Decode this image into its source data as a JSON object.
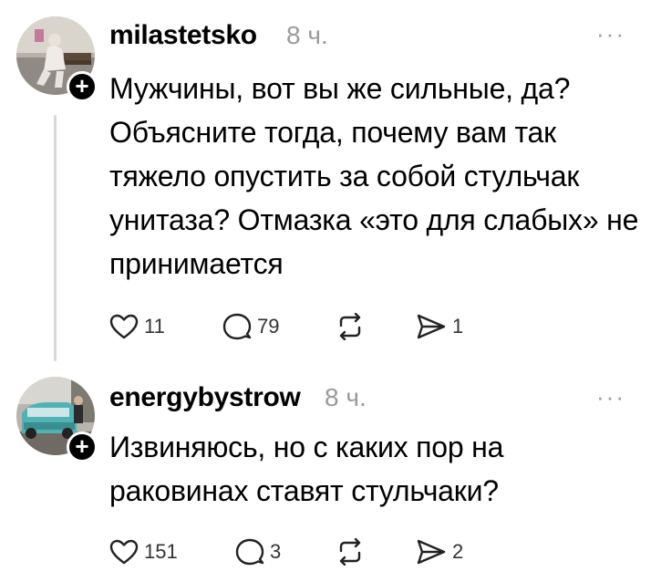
{
  "posts": [
    {
      "username": "milastetsko",
      "time": "8 ч.",
      "more": "···",
      "text": "Мужчины, вот вы же сильные, да? Объясните тогда, почему вам так тяжело опустить за собой стульчак унитаза? Отмазка «это для слабых» не принимается",
      "likes": "11",
      "comments": "79",
      "shares": "1"
    },
    {
      "username": "energybystrow",
      "time": "8 ч.",
      "more": "···",
      "text": "Извиняюсь, но с каких пор на раковинах ставят стульчаки?",
      "likes": "151",
      "comments": "3",
      "shares": "2"
    }
  ],
  "icons": {
    "like": "heart-icon",
    "comment": "comment-bubble-icon",
    "repost": "repost-icon",
    "share": "send-icon",
    "follow": "plus-icon"
  },
  "colors": {
    "text": "#000000",
    "muted": "#9a9a9a",
    "thread_line": "#d9d9d9"
  }
}
